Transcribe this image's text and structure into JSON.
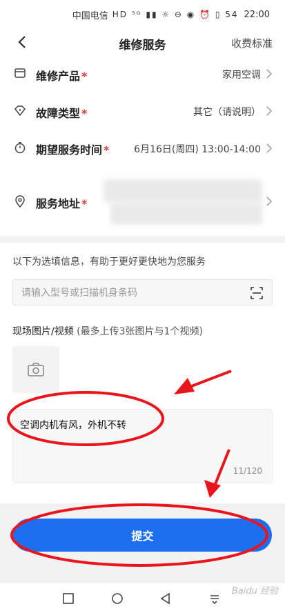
{
  "status_bar": {
    "carrier": "中国电信",
    "icons": "HD ⁵ᴳ ▮▮ ☼ ⊖ ◉ ⏰ ▯ 54",
    "time": "22:00"
  },
  "nav": {
    "title": "维修服务",
    "right_link": "收费标准"
  },
  "form": {
    "product": {
      "label": "维修产品",
      "required": "*",
      "value": "家用空调"
    },
    "fault": {
      "label": "故障类型",
      "required": "*",
      "value": "其它（请说明）"
    },
    "time": {
      "label": "期望服务时间",
      "required": "*",
      "value": "6月16日(周四) 13:00-14:00"
    },
    "address": {
      "label": "服务地址",
      "required": "*",
      "value": ""
    }
  },
  "optional": {
    "hint": "以下为选填信息，有助于更好更快地为您服务",
    "model_placeholder": "请输入型号或扫描机身条码",
    "media_title": "现场图片/视频",
    "media_note": "(最多上传3张图片与1个视频)",
    "description": "空调内机有风，外机不转",
    "char_count": "11/120"
  },
  "submit_label": "提交",
  "watermark": "Baidu 经验",
  "colors": {
    "accent": "#1e6ff0",
    "required": "#e53935",
    "annotation": "#e8161b"
  }
}
